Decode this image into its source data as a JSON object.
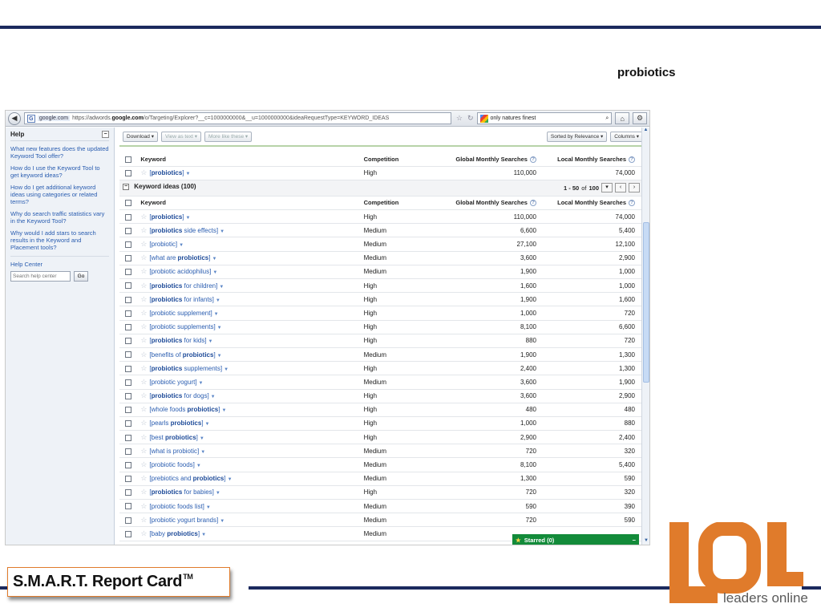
{
  "slide": {
    "title": "probiotics",
    "report_card": "S.M.A.R.T. Report Card",
    "report_card_tm": "TM",
    "logo_text": "leaders online"
  },
  "browser": {
    "back_icon": "back-arrow-icon",
    "url_domain": "google.com",
    "url_prefix": "https://adwords.",
    "url_bold": "google.com",
    "url_rest": "/o/Targeting/Explorer?__c=1000000000&__u=1000000000&ideaRequestType=KEYWORD_IDEAS",
    "search_query": "only natures finest"
  },
  "help": {
    "title": "Help",
    "links": [
      "What new features does the updated Keyword Tool offer?",
      "How do I use the Keyword Tool to get keyword ideas?",
      "How do I get additional keyword ideas using categories or related terms?",
      "Why do search traffic statistics vary in the Keyword Tool?",
      "Why would I add stars to search results in the Keyword and Placement tools?"
    ],
    "help_center": "Help Center",
    "search_placeholder": "Search help center",
    "go_label": "Go"
  },
  "toolbar": {
    "download": "Download ▾",
    "view_as_text": "View as text ▾",
    "more_like_these": "More like these ▾",
    "sorted_by": "Sorted by Relevance ▾",
    "columns": "Columns ▾"
  },
  "table": {
    "headers": {
      "keyword": "Keyword",
      "competition": "Competition",
      "global": "Global Monthly Searches",
      "local": "Local Monthly Searches"
    },
    "search_terms": [
      {
        "pre": "[",
        "bold": "probiotics",
        "post": "]",
        "competition": "High",
        "global": "110,000",
        "local": "74,000"
      }
    ],
    "ideas_title": "Keyword ideas (100)",
    "pager_range": "1 - 50",
    "pager_of": "of",
    "pager_total": "100",
    "ideas": [
      {
        "pre": "[",
        "bold": "probiotics",
        "post": "]",
        "competition": "High",
        "global": "110,000",
        "local": "74,000"
      },
      {
        "pre": "[",
        "bold": "probiotics",
        "post": " side effects]",
        "competition": "Medium",
        "global": "6,600",
        "local": "5,400"
      },
      {
        "pre": "[probiotic]",
        "bold": "",
        "post": "",
        "competition": "Medium",
        "global": "27,100",
        "local": "12,100"
      },
      {
        "pre": "[what are ",
        "bold": "probiotics",
        "post": "]",
        "competition": "Medium",
        "global": "3,600",
        "local": "2,900"
      },
      {
        "pre": "[probiotic acidophilus]",
        "bold": "",
        "post": "",
        "competition": "Medium",
        "global": "1,900",
        "local": "1,000"
      },
      {
        "pre": "[",
        "bold": "probiotics",
        "post": " for children]",
        "competition": "High",
        "global": "1,600",
        "local": "1,000"
      },
      {
        "pre": "[",
        "bold": "probiotics",
        "post": " for infants]",
        "competition": "High",
        "global": "1,900",
        "local": "1,600"
      },
      {
        "pre": "[probiotic supplement]",
        "bold": "",
        "post": "",
        "competition": "High",
        "global": "1,000",
        "local": "720"
      },
      {
        "pre": "[probiotic supplements]",
        "bold": "",
        "post": "",
        "competition": "High",
        "global": "8,100",
        "local": "6,600"
      },
      {
        "pre": "[",
        "bold": "probiotics",
        "post": " for kids]",
        "competition": "High",
        "global": "880",
        "local": "720"
      },
      {
        "pre": "[benefits of ",
        "bold": "probiotics",
        "post": "]",
        "competition": "Medium",
        "global": "1,900",
        "local": "1,300"
      },
      {
        "pre": "[",
        "bold": "probiotics",
        "post": " supplements]",
        "competition": "High",
        "global": "2,400",
        "local": "1,300"
      },
      {
        "pre": "[probiotic yogurt]",
        "bold": "",
        "post": "",
        "competition": "Medium",
        "global": "3,600",
        "local": "1,900"
      },
      {
        "pre": "[",
        "bold": "probiotics",
        "post": " for dogs]",
        "competition": "High",
        "global": "3,600",
        "local": "2,900"
      },
      {
        "pre": "[whole foods ",
        "bold": "probiotics",
        "post": "]",
        "competition": "High",
        "global": "480",
        "local": "480"
      },
      {
        "pre": "[pearls ",
        "bold": "probiotics",
        "post": "]",
        "competition": "High",
        "global": "1,000",
        "local": "880"
      },
      {
        "pre": "[best ",
        "bold": "probiotics",
        "post": "]",
        "competition": "High",
        "global": "2,900",
        "local": "2,400"
      },
      {
        "pre": "[what is probiotic]",
        "bold": "",
        "post": "",
        "competition": "Medium",
        "global": "720",
        "local": "320"
      },
      {
        "pre": "[probiotic foods]",
        "bold": "",
        "post": "",
        "competition": "Medium",
        "global": "8,100",
        "local": "5,400"
      },
      {
        "pre": "[prebiotics and ",
        "bold": "probiotics",
        "post": "]",
        "competition": "Medium",
        "global": "1,300",
        "local": "590"
      },
      {
        "pre": "[",
        "bold": "probiotics",
        "post": " for babies]",
        "competition": "High",
        "global": "720",
        "local": "320"
      },
      {
        "pre": "[probiotic foods list]",
        "bold": "",
        "post": "",
        "competition": "Medium",
        "global": "590",
        "local": "390"
      },
      {
        "pre": "[probiotic yogurt brands]",
        "bold": "",
        "post": "",
        "competition": "Medium",
        "global": "720",
        "local": "590"
      },
      {
        "pre": "[baby ",
        "bold": "probiotics",
        "post": "]",
        "competition": "Medium",
        "global": "",
        "local": ""
      }
    ]
  },
  "starred": {
    "label": "Starred (0)",
    "close": "−"
  },
  "colors": {
    "navy_rule": "#1b2a5e",
    "orange_logo": "#e07b2b",
    "starred_green": "#138b3a",
    "link_blue": "#2a5db0"
  }
}
